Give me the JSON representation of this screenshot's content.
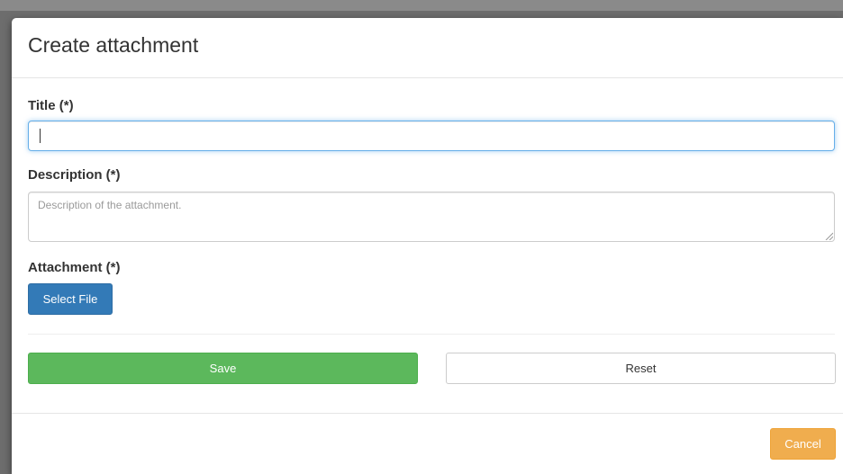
{
  "modal": {
    "title": "Create attachment"
  },
  "form": {
    "title_label": "Title (*)",
    "title_value": "",
    "description_label": "Description (*)",
    "description_placeholder": "Description of the attachment.",
    "attachment_label": "Attachment (*)",
    "select_file_label": "Select File"
  },
  "actions": {
    "save_label": "Save",
    "reset_label": "Reset",
    "cancel_label": "Cancel"
  },
  "colors": {
    "primary": "#337ab7",
    "success": "#5cb85c",
    "warning": "#f0ad4e",
    "focus": "#66afe9"
  }
}
